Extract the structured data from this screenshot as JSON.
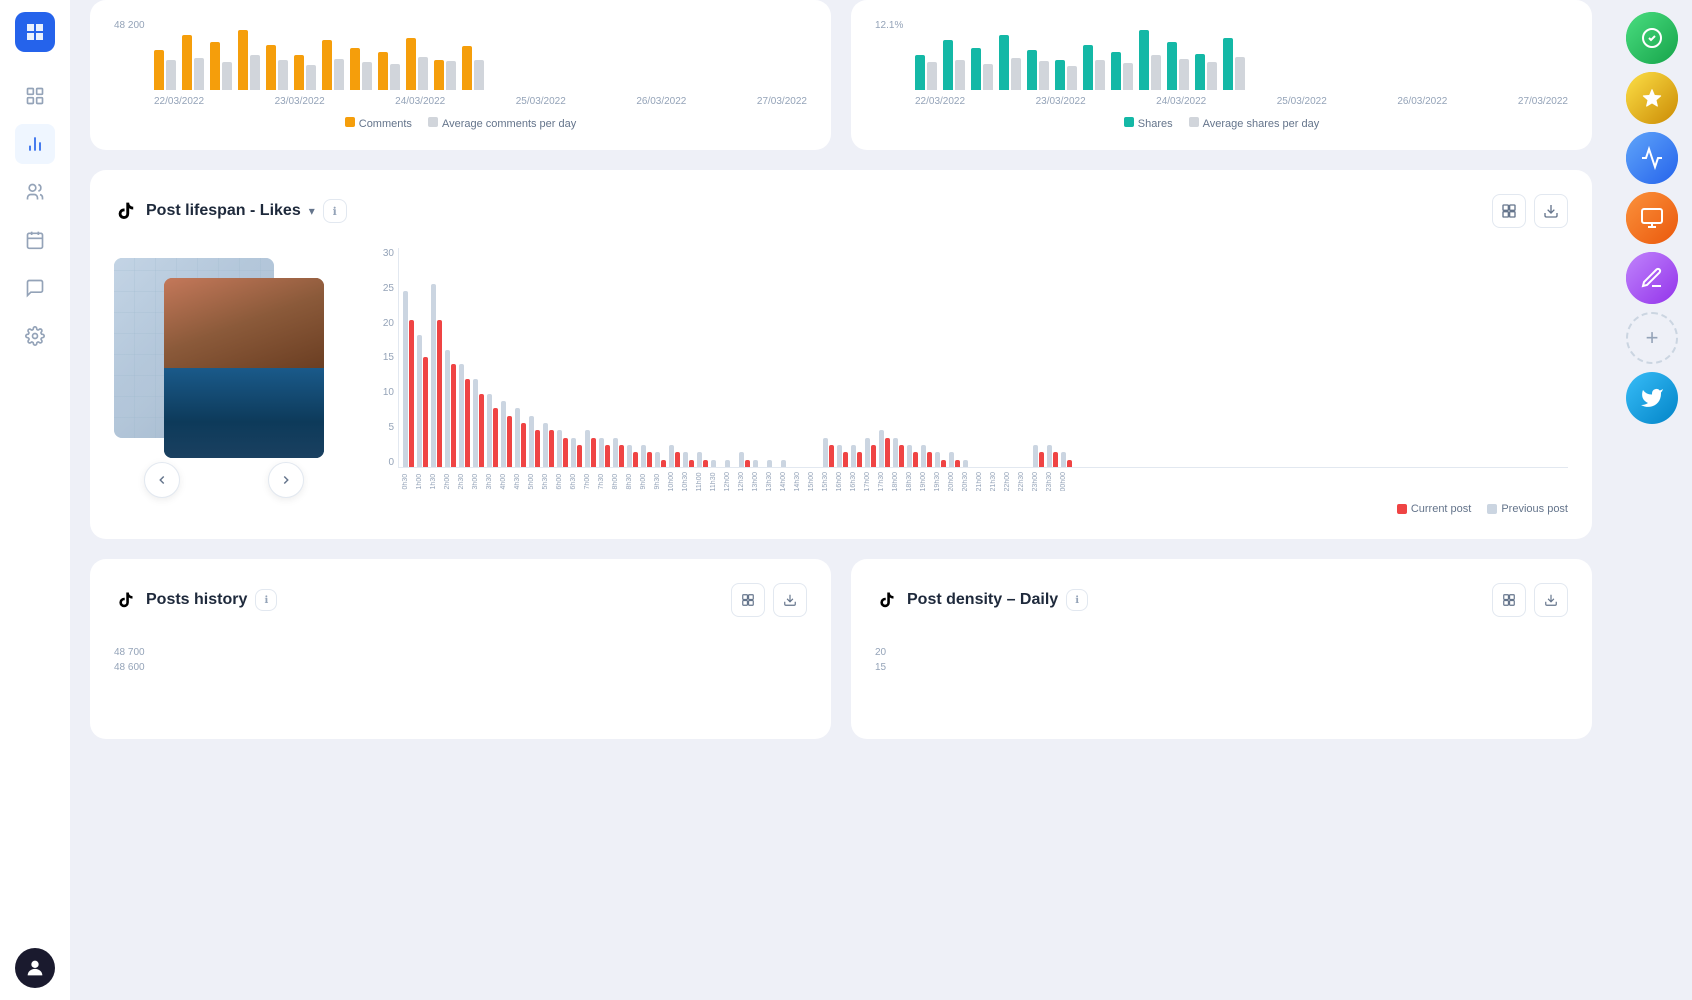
{
  "sidebar": {
    "logo_alt": "App Logo",
    "items": [
      {
        "name": "grid-icon",
        "label": "Dashboard",
        "active": false
      },
      {
        "name": "chart-icon",
        "label": "Analytics",
        "active": true
      },
      {
        "name": "users-icon",
        "label": "Audience",
        "active": false
      },
      {
        "name": "calendar-icon",
        "label": "Schedule",
        "active": false
      },
      {
        "name": "message-icon",
        "label": "Messages",
        "active": false
      },
      {
        "name": "settings-icon",
        "label": "Settings",
        "active": false
      }
    ]
  },
  "top_charts": {
    "comments_card": {
      "y_label": "48 200",
      "dates": [
        "22/03/2022",
        "23/03/2022",
        "24/03/2022",
        "25/03/2022",
        "26/03/2022",
        "27/03/2022"
      ],
      "legend": {
        "comments": "Comments",
        "average": "Average comments per day"
      }
    },
    "shares_card": {
      "y_label": "12.1%",
      "dates": [
        "22/03/2022",
        "23/03/2022",
        "24/03/2022",
        "25/03/2022",
        "26/03/2022",
        "27/03/2022"
      ],
      "legend": {
        "shares": "Shares",
        "average": "Average shares per day"
      }
    }
  },
  "post_lifespan": {
    "title": "Post lifespan – Likes",
    "tiktok_icon": "♪",
    "dropdown_label": "Post lifespan - Likes",
    "info_icon": "ℹ",
    "layout_icon": "⊞",
    "download_icon": "⬇",
    "y_axis": [
      "30",
      "25",
      "20",
      "15",
      "10",
      "5",
      "0"
    ],
    "x_labels": [
      "0h30",
      "1h00",
      "1h30",
      "2h00",
      "2h30",
      "3h00",
      "3h30",
      "4h00",
      "4h30",
      "5h00",
      "5h30",
      "6h00",
      "6h30",
      "7h00",
      "7h30",
      "8h00",
      "8h30",
      "9h00",
      "9h30",
      "10h00",
      "10h30",
      "11h00",
      "11h30",
      "12h00",
      "12h30",
      "13h00",
      "13h30",
      "14h00",
      "14h30",
      "15h00",
      "15h30",
      "16h00",
      "16h30",
      "17h00",
      "17h30",
      "18h00",
      "18h30",
      "19h00",
      "19h30",
      "20h00",
      "20h30",
      "21h00",
      "21h30",
      "22h00",
      "22h30",
      "23h00",
      "23h30",
      "00h00"
    ],
    "current_bars": [
      20,
      15,
      20,
      14,
      12,
      10,
      8,
      7,
      6,
      5,
      5,
      4,
      3,
      4,
      3,
      3,
      2,
      2,
      1,
      2,
      1,
      1,
      0,
      0,
      1,
      0,
      0,
      0,
      0,
      0,
      3,
      2,
      2,
      3,
      4,
      3,
      2,
      2,
      1,
      1,
      0,
      0,
      0,
      0,
      0,
      2,
      2,
      1
    ],
    "prev_bars": [
      24,
      18,
      25,
      16,
      14,
      12,
      10,
      9,
      8,
      7,
      6,
      5,
      4,
      5,
      4,
      4,
      3,
      3,
      2,
      3,
      2,
      2,
      1,
      1,
      2,
      1,
      1,
      1,
      0,
      0,
      4,
      3,
      3,
      4,
      5,
      4,
      3,
      3,
      2,
      2,
      1,
      0,
      0,
      0,
      0,
      3,
      3,
      2
    ],
    "legend": {
      "current": "Current post",
      "previous": "Previous post"
    },
    "nav_prev": "‹",
    "nav_next": "›"
  },
  "bottom_cards": {
    "posts_history": {
      "title": "Posts history",
      "tiktok_icon": "♪",
      "info_icon": "ℹ",
      "layout_icon": "⊞",
      "download_icon": "⬇",
      "y_labels": [
        "48 700",
        "48 600"
      ]
    },
    "post_density": {
      "title": "Post density – Daily",
      "tiktok_icon": "♪",
      "info_icon": "ℹ",
      "layout_icon": "⊞",
      "download_icon": "⬇",
      "y_labels": [
        "20",
        "15"
      ]
    }
  },
  "right_panel": {
    "bubbles": [
      {
        "color": "green",
        "icon": "✓"
      },
      {
        "color": "yellow",
        "icon": "★"
      },
      {
        "color": "blue",
        "icon": "▲"
      },
      {
        "color": "orange",
        "icon": "●"
      },
      {
        "color": "purple",
        "icon": "✎"
      },
      {
        "color": "add",
        "icon": "+"
      },
      {
        "color": "twitter",
        "icon": "🐦"
      }
    ]
  }
}
